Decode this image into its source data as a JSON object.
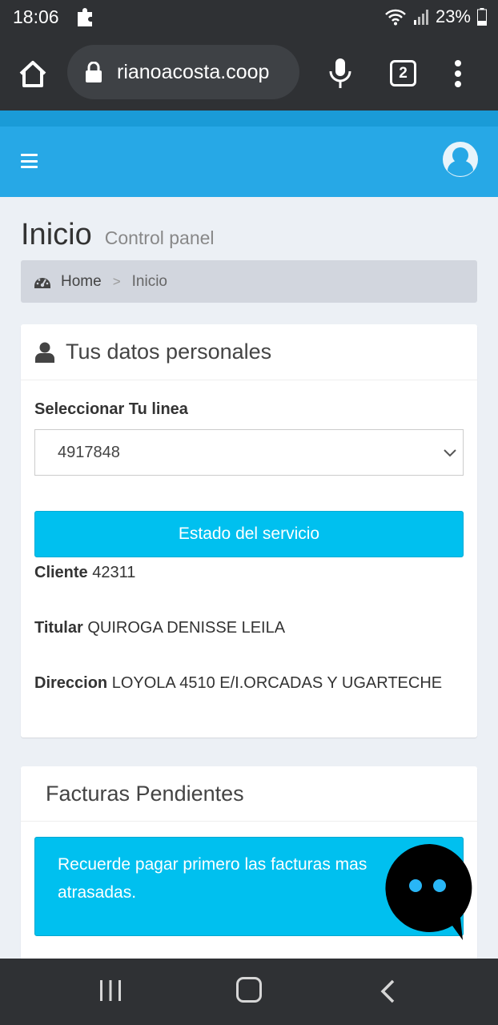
{
  "status_bar": {
    "time": "18:06",
    "battery": "23%"
  },
  "browser": {
    "url": "rianoacosta.coop",
    "tab_count": "2"
  },
  "page": {
    "title": "Inicio",
    "subtitle": "Control panel"
  },
  "breadcrumb": {
    "home": "Home",
    "separator": ">",
    "current": "Inicio"
  },
  "personal": {
    "header": "Tus datos personales",
    "select_label": "Seleccionar Tu linea",
    "selected_line": "4917848",
    "service_button": "Estado del servicio",
    "cliente_label": "Cliente",
    "cliente_value": "42311",
    "titular_label": "Titular",
    "titular_value": "QUIROGA DENISSE LEILA",
    "direccion_label": "Direccion",
    "direccion_value": "LOYOLA 4510 E/I.ORCADAS Y UGARTECHE"
  },
  "facturas": {
    "header": "Facturas Pendientes",
    "callout": "Recuerde pagar primero las facturas mas atrasadas."
  },
  "icons": {
    "home": "home-icon",
    "lock": "lock-icon",
    "mic": "mic-icon",
    "menu": "more-vert-icon",
    "hamburger": "hamburger-icon",
    "avatar": "user-avatar-icon",
    "gauge": "dashboard-icon",
    "user": "user-icon",
    "chat": "chat-icon"
  },
  "colors": {
    "header": "#27a8e6",
    "accent": "#00c0ef",
    "chrome": "#2f3134",
    "background": "#ecf0f5"
  }
}
